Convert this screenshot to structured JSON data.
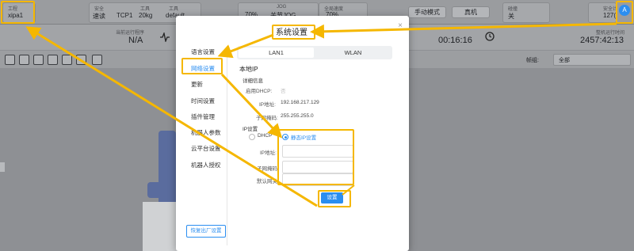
{
  "status_bar": {
    "project_label": "工程",
    "project_value": "xipa1",
    "safety_label": "安全",
    "safety_value": "速读",
    "tool_label": "工具",
    "tool_value": "TCP1",
    "payload_value": "20kg",
    "tool_right_label": "工具",
    "tool_right_value": "default",
    "jog_speed_label": "JOG",
    "jog_speed_value": "70%",
    "jog_mode_label": "JOG",
    "jog_mode_value": "关节JOG",
    "global_speed_label": "全局速度",
    "global_speed_value": "70%",
    "manual_mode": "手动模式",
    "real_machine": "真机",
    "collision_label": "碰撞",
    "collision_value": "关",
    "safety_count_label": "安全计",
    "safety_count_value": "127(",
    "avatar_letter": "A"
  },
  "info_bar": {
    "current_run_label": "当前运行程序",
    "current_run_value": "N/A",
    "time_value": "00:16:16",
    "run_time_label": "整机运行时间",
    "run_time_value": "2457:42:13",
    "group_label": "帧组:",
    "group_value": "全部"
  },
  "modal": {
    "title": "系统设置",
    "close": "×",
    "menu": [
      "语言设置",
      "网络设置",
      "更新",
      "时间设置",
      "插件管理",
      "机器人参数",
      "云平台设置",
      "机器人授权"
    ],
    "reset_button": "恢复出厂设置",
    "tabs": [
      "LAN1",
      "WLAN"
    ],
    "local_ip_title": "本地IP",
    "details_title": "详细信息",
    "dhcp_enable_label": "启用DHCP:",
    "dhcp_enable_value": "否",
    "ip_label": "IP地址:",
    "ip_value": "192.168.217.129",
    "subnet_label": "子网掩码:",
    "subnet_value": "255.255.255.0",
    "ip_settings_title": "IP设置",
    "radio_dhcp": "DHCP",
    "radio_static": "静态IP设置",
    "form_ip_label": "IP地址:",
    "form_subnet_label": "子网掩码:",
    "form_gateway_label": "默认网关:",
    "save_button": "设置"
  },
  "colors": {
    "accent": "#2b8ef0",
    "highlight": "#f5b700"
  }
}
